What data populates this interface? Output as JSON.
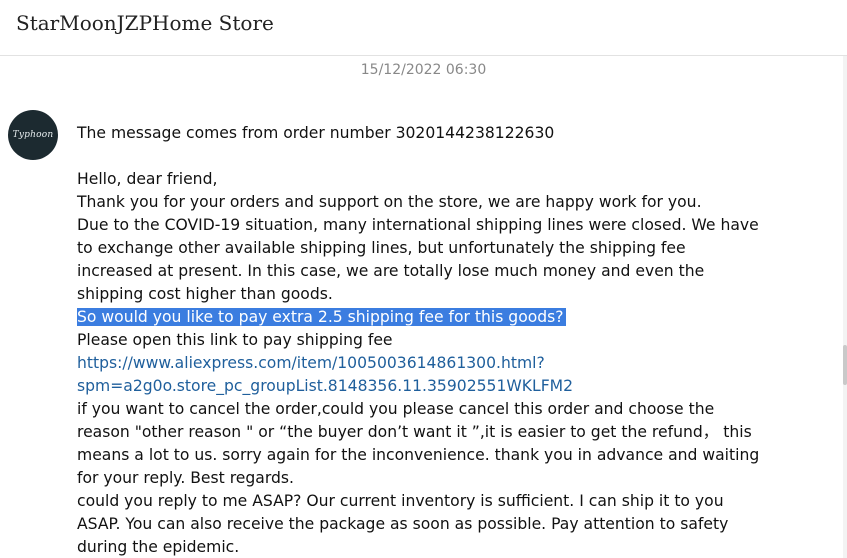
{
  "header": {
    "store_name": "StarMoonJZPHome Store"
  },
  "conversation": {
    "timestamp": "15/12/2022 06:30",
    "sender_avatar_text": "Typhoon",
    "message_lines": [
      "The message comes from order number 3020144238122630",
      "",
      "Hello, dear friend,",
      "Thank you for your orders and support on the store, we are happy work for you.",
      "Due to the COVID-19 situation, many international shipping lines were closed. We have",
      "to exchange other available shipping lines, but unfortunately the shipping fee",
      "increased at present. In this case, we are totally lose much money and even the",
      "shipping cost higher than goods.",
      "So would you like to pay extra 2.5 shipping fee for this goods?",
      "Please open this link to pay shipping fee",
      "https://www.aliexpress.com/item/1005003614861300.html?",
      "spm=a2g0o.store_pc_groupList.8148356.11.35902551WKLFM2",
      "if you want to cancel the order,could you please cancel this order and choose the",
      "reason \"other reason \" or “the buyer don’t want it ”,it is easier to get the refund，  this",
      "means a lot to us. sorry again for the inconvenience. thank you in advance and waiting",
      "for your reply. Best regards.",
      "could you reply to me ASAP? Our current inventory is sufficient. I can ship it to you",
      "ASAP. You can also receive the package as soon as possible. Pay attention to safety",
      "during the epidemic."
    ]
  },
  "colors": {
    "highlight": "#3b7de0",
    "link": "#1f5f9c",
    "timestamp": "#888888"
  }
}
